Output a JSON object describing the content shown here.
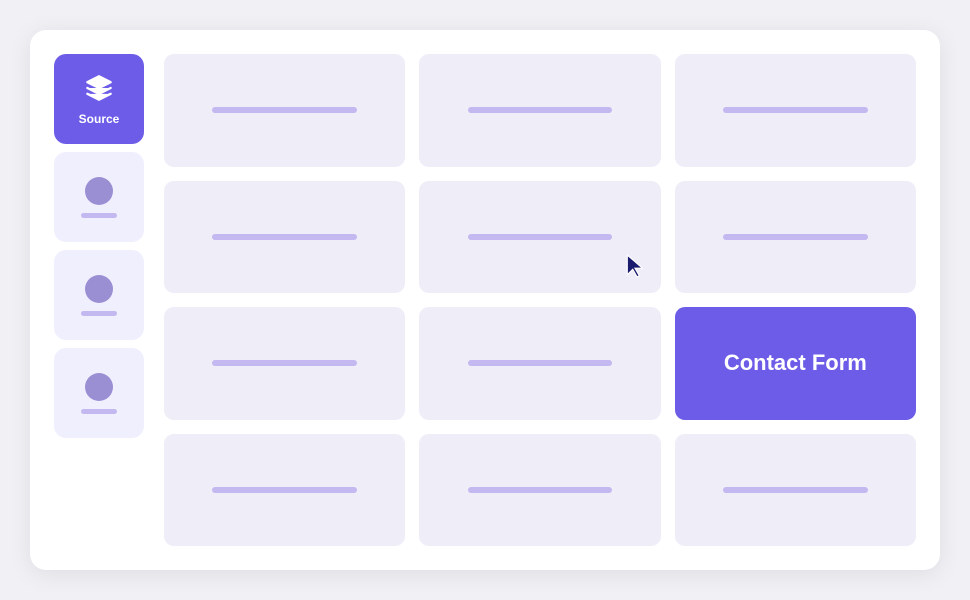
{
  "sidebar": {
    "items": [
      {
        "id": "source",
        "label": "Source",
        "type": "active",
        "icon": "layers"
      },
      {
        "id": "user1",
        "label": "",
        "type": "inactive",
        "icon": "avatar"
      },
      {
        "id": "user2",
        "label": "",
        "type": "inactive",
        "icon": "avatar"
      },
      {
        "id": "user3",
        "label": "",
        "type": "inactive",
        "icon": "avatar"
      }
    ]
  },
  "grid": {
    "rows": 4,
    "cols": 3,
    "contact_form": {
      "row": 3,
      "col": 3,
      "label": "Contact Form"
    }
  },
  "colors": {
    "active_bg": "#6c5ce7",
    "inactive_bg": "#f0effe",
    "card_bg": "#eeedf8",
    "card_bar": "#c4b8f0",
    "contact_form_bg": "#6c5ce7",
    "contact_form_text": "#ffffff"
  }
}
